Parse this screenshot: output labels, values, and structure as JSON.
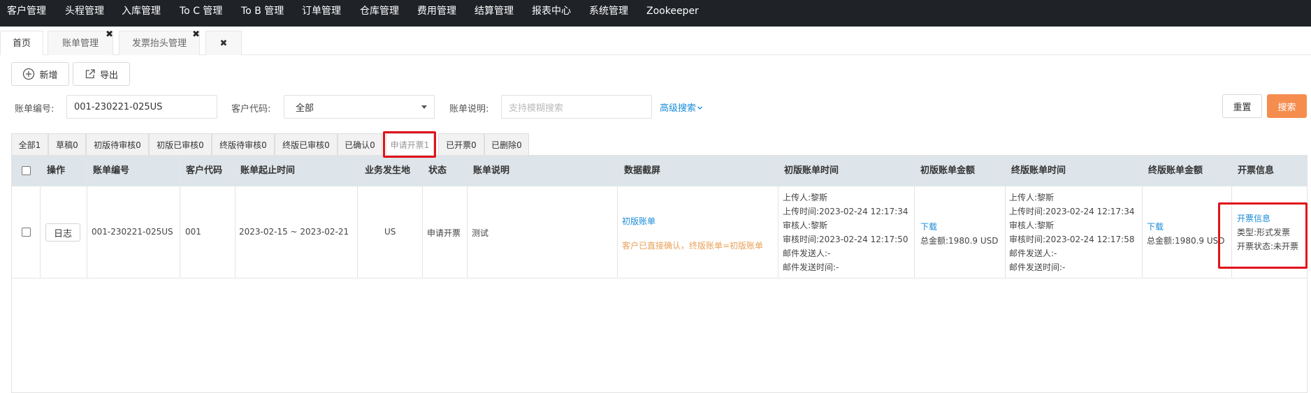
{
  "topnav": {
    "items": [
      "客户管理",
      "头程管理",
      "入库管理",
      "To C 管理",
      "To B 管理",
      "订单管理",
      "仓库管理",
      "费用管理",
      "结算管理",
      "报表中心",
      "系统管理",
      "Zookeeper"
    ]
  },
  "tabs": {
    "home": "首页",
    "bill": "账单管理",
    "invoice_header": "发票抬头管理",
    "close_all": "✖"
  },
  "toolbar": {
    "add_label": "新增",
    "export_label": "导出"
  },
  "filters": {
    "bill_no_label": "账单编号:",
    "bill_no_value": "001-230221-025US",
    "customer_code_label": "客户代码:",
    "customer_code_value": "全部",
    "bill_desc_label": "账单说明:",
    "bill_desc_placeholder": "支持模糊搜索",
    "advanced_search": "高级搜索",
    "reset": "重置",
    "search": "搜索"
  },
  "status_tabs": [
    "全部1",
    "草稿0",
    "初版待审核0",
    "初版已审核0",
    "终版待审核0",
    "终版已审核0",
    "已确认0",
    "申请开票1",
    "已开票0",
    "已删除0"
  ],
  "active_status_tab": "申请开票1",
  "table": {
    "headers": {
      "op": "操作",
      "bill_no": "账单编号",
      "customer_code": "客户代码",
      "period": "账单起止时间",
      "location": "业务发生地",
      "status": "状态",
      "desc": "账单说明",
      "screenshot": "数据截屏",
      "draft_time": "初版账单时间",
      "draft_amount": "初版账单金额",
      "final_time": "终版账单时间",
      "final_amount": "终版账单金额",
      "invoice": "开票信息"
    },
    "row": {
      "log_button": "日志",
      "bill_no": "001-230221-025US",
      "customer_code": "001",
      "period": "2023-02-15 ~ 2023-02-21",
      "location": "US",
      "status": "申请开票",
      "desc": "测试",
      "screenshot_link": "初版账单",
      "screenshot_note": "客户已直接确认，终版账单=初版账单",
      "draft_time_lines": [
        "上传人:黎斯",
        "上传时间:2023-02-24 12:17:34",
        "审核人:黎斯",
        "审核时间:2023-02-24 12:17:50",
        "邮件发送人:-",
        "邮件发送时间:-"
      ],
      "draft_download": "下载",
      "draft_total": "总金额:1980.9 USD",
      "final_time_lines": [
        "上传人:黎斯",
        "上传时间:2023-02-24 12:17:34",
        "审核人:黎斯",
        "审核时间:2023-02-24 12:17:58",
        "邮件发送人:-",
        "邮件发送时间:-"
      ],
      "final_download": "下载",
      "final_total": "总金额:1980.9 USD",
      "invoice_link": "开票信息",
      "invoice_type": "类型:形式发票",
      "invoice_status": "开票状态:未开票"
    }
  },
  "colors": {
    "topnav_bg": "#1f2227",
    "table_header_bg": "#dde5ea",
    "link": "#1a8bd8",
    "search_button": "#f58d4f",
    "highlight_box": "#e0121b",
    "note_orange": "#e8a25a"
  }
}
